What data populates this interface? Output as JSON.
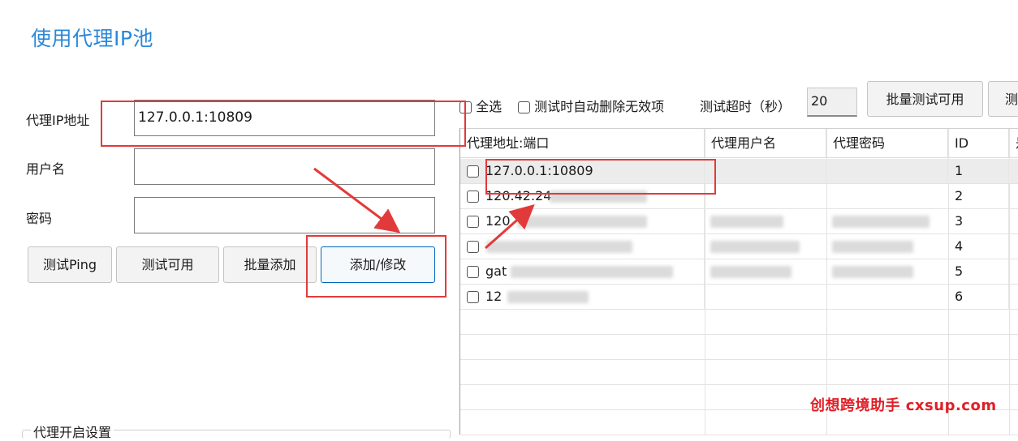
{
  "page_title": "使用代理IP池",
  "form": {
    "ip_label": "代理IP地址",
    "ip_value": "127.0.0.1:10809",
    "user_label": "用户名",
    "user_value": "",
    "pass_label": "密码",
    "pass_value": ""
  },
  "buttons": {
    "test_ping": "测试Ping",
    "test_available": "测试可用",
    "batch_add": "批量添加",
    "add_modify": "添加/修改"
  },
  "toolbar": {
    "select_all": "全选",
    "auto_delete": "测试时自动删除无效项",
    "timeout_label": "测试超时（秒）",
    "timeout_value": "20",
    "batch_test": "批量测试可用",
    "next_button_partial": "测"
  },
  "grid": {
    "columns": [
      "代理地址:端口",
      "代理用户名",
      "代理密码",
      "ID",
      "是"
    ],
    "rows": [
      {
        "address": "127.0.0.1:10809",
        "user": "",
        "password": "",
        "id": "1"
      },
      {
        "address": "120.42.24",
        "user": "",
        "password": "",
        "id": "2"
      },
      {
        "address": "120",
        "user": "",
        "password": "",
        "id": "3"
      },
      {
        "address": "",
        "user": "",
        "password": "",
        "id": "4"
      },
      {
        "address": "gat",
        "user": "",
        "password": "",
        "id": "5"
      },
      {
        "address": "12",
        "user": "",
        "password": "",
        "id": "6"
      }
    ]
  },
  "section_label": "代理开启设置",
  "watermark": "创想跨境助手 cxsup.com",
  "colors": {
    "accent": "#2b88d8",
    "annotation_red": "#e23a3a",
    "watermark_red": "#e01f26"
  }
}
